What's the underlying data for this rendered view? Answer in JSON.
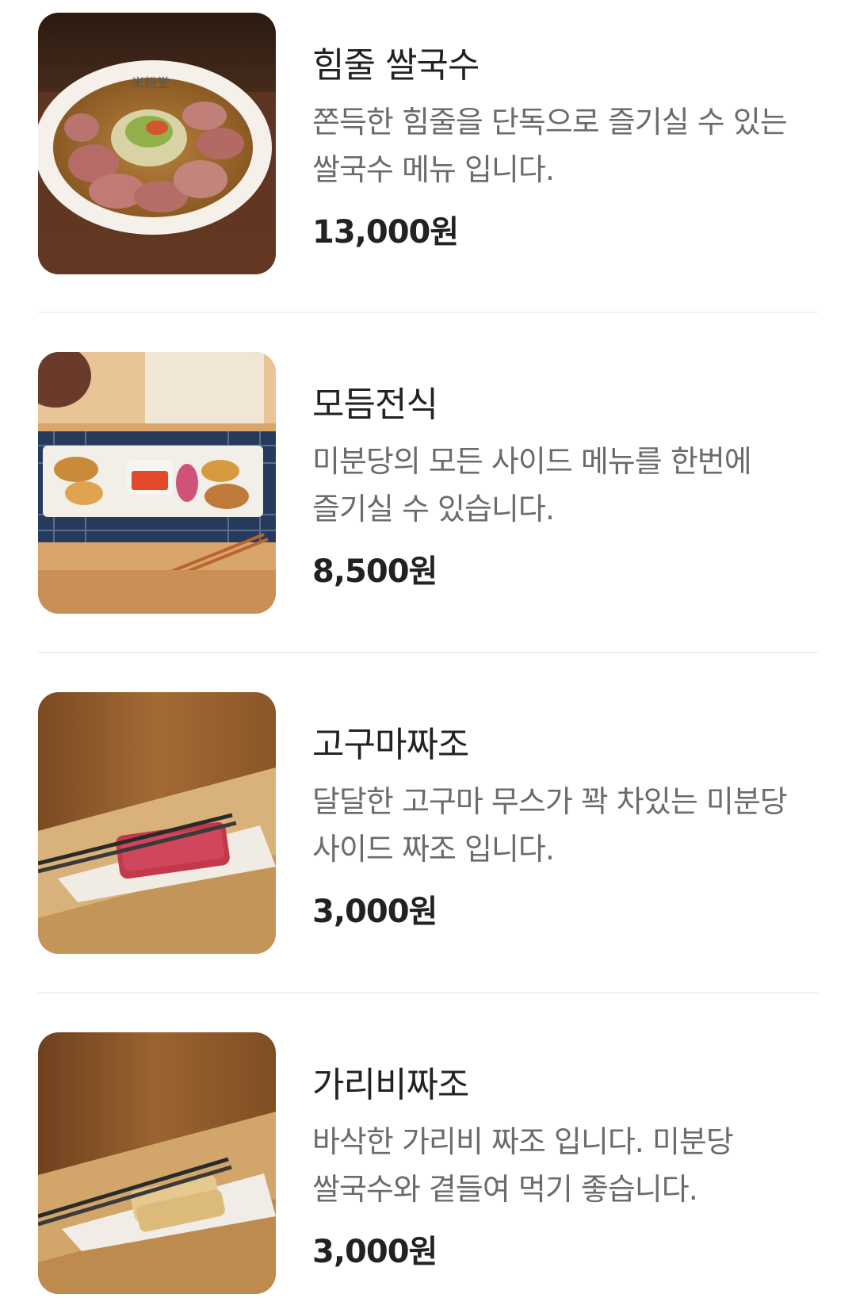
{
  "menu": {
    "items": [
      {
        "name": "힘줄 쌀국수",
        "description": "쫀득한 힘줄을 단독으로 즐기실 수 있는 쌀국수 메뉴 입니다.",
        "price": "13,000원",
        "image_icon": "pho-bowl-photo"
      },
      {
        "name": "모듬전식",
        "description": "미분당의 모든 사이드 메뉴를 한번에 즐기실 수 있습니다.",
        "price": "8,500원",
        "image_icon": "side-platter-photo"
      },
      {
        "name": "고구마짜조",
        "description": "달달한 고구마 무스가 꽉 차있는 미분당 사이드 짜조 입니다.",
        "price": "3,000원",
        "image_icon": "sweet-potato-spring-roll-photo"
      },
      {
        "name": "가리비짜조",
        "description": "바삭한 가리비 짜조 입니다. 미분당 쌀국수와 곁들여 먹기 좋습니다.",
        "price": "3,000원",
        "image_icon": "scallop-spring-roll-photo"
      }
    ]
  },
  "colors": {
    "title": "#222222",
    "description": "#6b6b6b",
    "price": "#222222",
    "divider": "#f1f1f1",
    "background": "#ffffff"
  }
}
